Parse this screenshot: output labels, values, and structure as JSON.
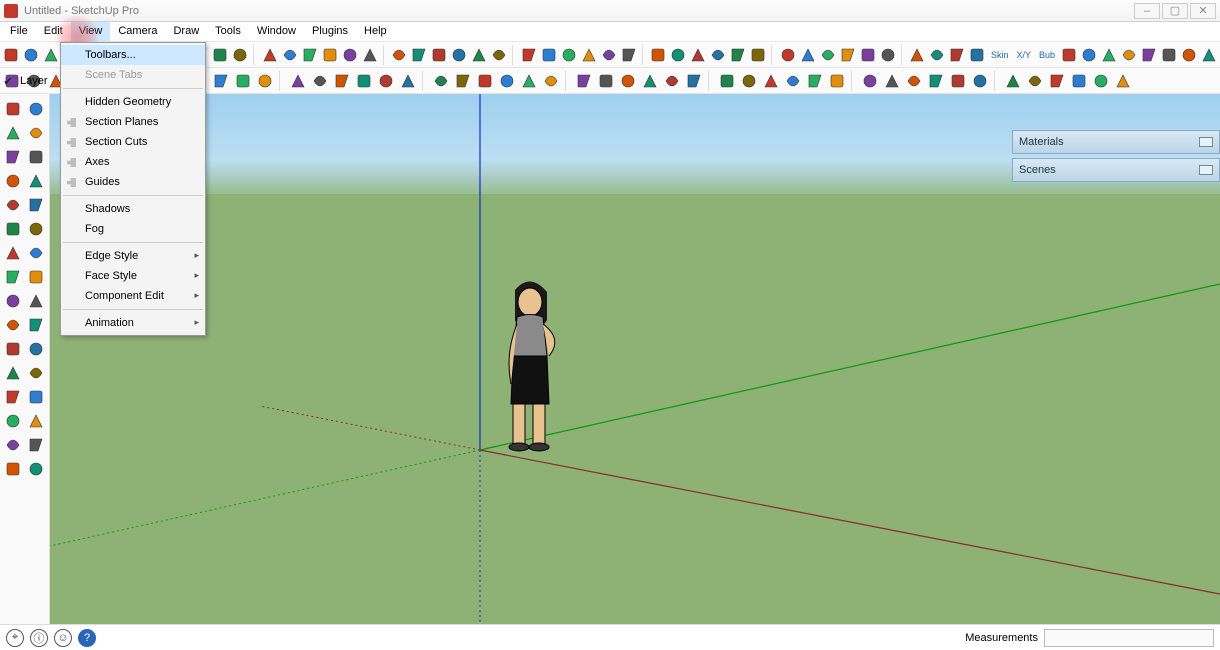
{
  "window": {
    "title": "Untitled - SketchUp Pro",
    "controls": {
      "min": "–",
      "max": "▢",
      "close": "✕"
    }
  },
  "menubar": [
    "File",
    "Edit",
    "View",
    "Camera",
    "Draw",
    "Tools",
    "Window",
    "Plugins",
    "Help"
  ],
  "active_menu_index": 2,
  "view_menu": {
    "items": [
      {
        "label": "Toolbars...",
        "hl": true
      },
      {
        "label": "Scene Tabs",
        "dis": true
      },
      {
        "sep": true
      },
      {
        "label": "Hidden Geometry"
      },
      {
        "label": "Section Planes",
        "chk": true
      },
      {
        "label": "Section Cuts",
        "chk": true
      },
      {
        "label": "Axes",
        "chk": true
      },
      {
        "label": "Guides",
        "chk": true
      },
      {
        "sep": true
      },
      {
        "label": "Shadows"
      },
      {
        "label": "Fog"
      },
      {
        "sep": true
      },
      {
        "label": "Edge Style",
        "sub": true
      },
      {
        "label": "Face Style",
        "sub": true
      },
      {
        "label": "Component Edit",
        "sub": true
      },
      {
        "sep": true
      },
      {
        "label": "Animation",
        "sub": true
      }
    ]
  },
  "layer_strip": {
    "label": "Layer"
  },
  "panels": {
    "materials": "Materials",
    "scenes": "Scenes"
  },
  "statusbar": {
    "measurements_label": "Measurements",
    "measurements_value": ""
  },
  "toolbar_row1_labels": {
    "skin": "Skin",
    "xy": "X/Y",
    "bub": "Bub"
  },
  "left_tools": [
    "select",
    "paint",
    "eraser",
    "line",
    "arc",
    "rectangle",
    "circle",
    "polygon",
    "freehand",
    "offset",
    "pushpull",
    "move",
    "rotate",
    "scale",
    "followme",
    "tape",
    "protractor",
    "text",
    "axes",
    "dimension",
    "3dtext",
    "orbit",
    "pan",
    "zoom",
    "zoomwin",
    "zoomext",
    "prev",
    "next",
    "section",
    "walk",
    "look",
    "position"
  ]
}
